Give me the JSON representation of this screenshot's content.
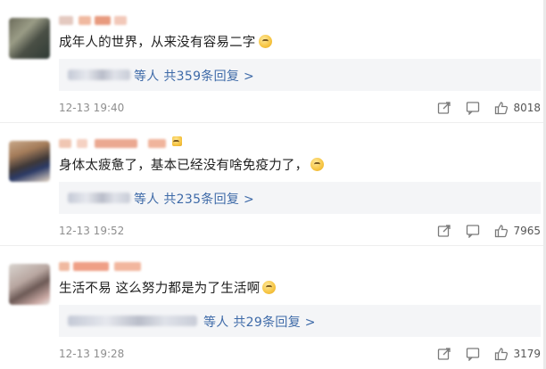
{
  "comments": [
    {
      "text": "成年人的世界，从来没有容易二字",
      "reply_suffix": "等人",
      "reply_count_label": "共359条回复 >",
      "time": "12-13 19:40",
      "likes": "8018"
    },
    {
      "text": "身体太疲惫了，基本已经没有啥免疫力了，",
      "reply_suffix": "等人",
      "reply_count_label": "共235条回复 >",
      "time": "12-13 19:52",
      "likes": "7965"
    },
    {
      "text": "生活不易 这么努力都是为了生活啊",
      "reply_suffix": "等人",
      "reply_count_label": "共29条回复 >",
      "time": "12-13 19:28",
      "likes": "3179"
    }
  ],
  "icons": {
    "repost": "share-edit-icon",
    "comment": "comment-icon",
    "like": "thumbs-up-icon"
  },
  "colors": {
    "link": "#3e6aa8",
    "meta": "#8e8e8e",
    "reply_bg": "#f4f5f7"
  }
}
